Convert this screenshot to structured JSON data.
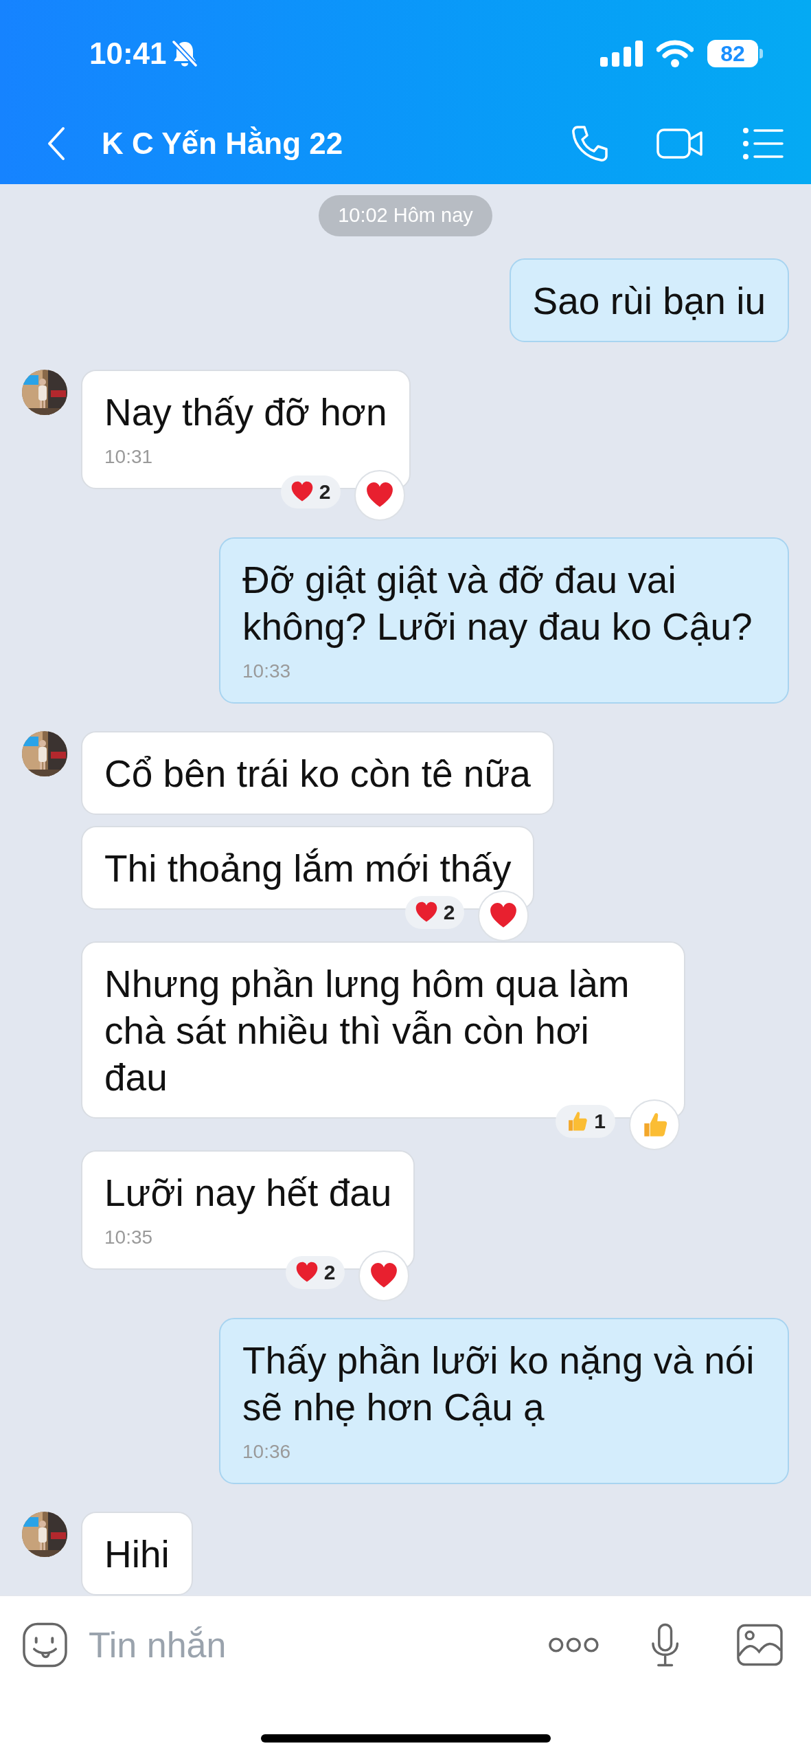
{
  "status_bar": {
    "time": "10:41",
    "muted": true,
    "battery": "82"
  },
  "header": {
    "title": "K C Yến Hằng 22"
  },
  "date_separator": "10:02 Hôm nay",
  "messages": [
    {
      "kind": "out",
      "text": "Sao rùi bạn iu"
    },
    {
      "kind": "in",
      "avatar": true,
      "text": "Nay thấy đỡ hơn",
      "time": "10:31",
      "reaction": {
        "kind": "heart",
        "count": "2"
      }
    },
    {
      "kind": "out",
      "text": "Đỡ giật giật và đỡ đau vai không? Lưỡi nay đau ko Cậu?",
      "time": "10:33"
    },
    {
      "kind": "in",
      "avatar": true,
      "text": "Cổ bên trái ko còn tê nữa"
    },
    {
      "kind": "in",
      "avatar": false,
      "text": "Thi thoảng lắm mới thấy",
      "reaction": {
        "kind": "heart",
        "count": "2"
      }
    },
    {
      "kind": "in",
      "avatar": false,
      "text": "Nhưng phần lưng hôm qua làm chà sát nhiều thì vẫn còn hơi đau",
      "reaction": {
        "kind": "like",
        "count": "1"
      }
    },
    {
      "kind": "in",
      "avatar": false,
      "text": "Lưỡi nay hết đau",
      "time": "10:35",
      "reaction": {
        "kind": "heart",
        "count": "2"
      }
    },
    {
      "kind": "out",
      "text": "Thấy phần lưỡi ko nặng và nói sẽ nhẹ hơn Cậu ạ",
      "time": "10:36"
    },
    {
      "kind": "in",
      "avatar": true,
      "text": "Hihi"
    }
  ],
  "composer": {
    "placeholder": "Tin nhắn"
  }
}
